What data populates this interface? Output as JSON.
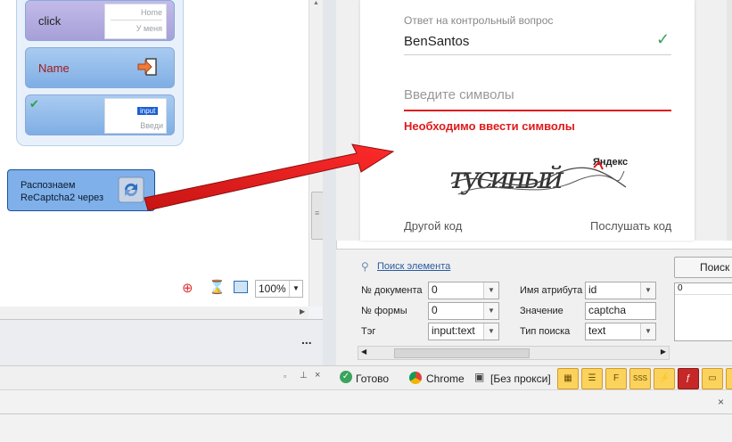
{
  "workflow": {
    "blocks": [
      {
        "label": "click",
        "mini_lines": [
          "Home",
          "У меня"
        ]
      },
      {
        "label": "Name"
      },
      {
        "label": "",
        "mini_tag": "input",
        "mini_text": "Введи"
      }
    ],
    "recaptcha_block": {
      "line1": "Распознаем",
      "line2": "ReCaptcha2 через"
    },
    "zoom": "100%",
    "more": "..."
  },
  "browser_page": {
    "security_label": "Ответ на контрольный вопрос",
    "security_value": "BenSantos",
    "captcha_placeholder": "Введите символы",
    "error_text": "Необходимо ввести символы",
    "captcha_brand": "Яндекс",
    "captcha_word": "тусиный",
    "other_code": "Другой код",
    "listen_code": "Послушать код"
  },
  "search_panel": {
    "search_link": "Поиск элемента",
    "search_button": "Поиск",
    "doc_label": "№ документа",
    "doc_value": "0",
    "form_label": "№ формы",
    "form_value": "0",
    "tag_label": "Тэг",
    "tag_value": "input:text",
    "attr_label": "Имя атрибута",
    "attr_value": "id",
    "value_label": "Значение",
    "value_value": "captcha",
    "search_type_label": "Тип поиска",
    "search_type_value": "text",
    "result_list_first": "0"
  },
  "status": {
    "ready": "Готово",
    "browser": "Chrome",
    "proxy": "[Без прокси]",
    "tools": [
      "img",
      "list",
      "F",
      "SSS",
      "⚡",
      "flash",
      "scr"
    ]
  },
  "colors": {
    "arrow": "#e41b1b",
    "block_click": "#a79fd8",
    "block_blue": "#8fb9e8",
    "error": "#e01b1b",
    "check": "#3aa35c"
  }
}
